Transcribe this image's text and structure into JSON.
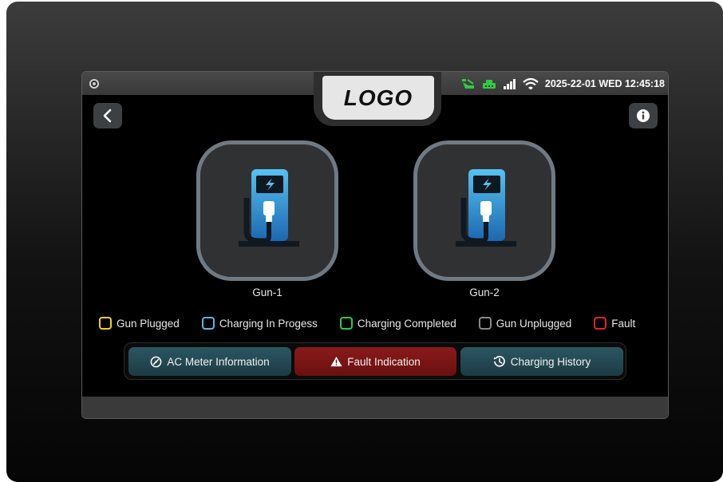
{
  "logo": {
    "text": "LOGO"
  },
  "status_bar": {
    "datetime": "2025-22-01 WED 12:45:18",
    "icons": [
      "camera-icon",
      "ev-connection-icon",
      "network-icon",
      "signal-bars-icon",
      "wifi-icon"
    ],
    "icon_color": "#2ecc40"
  },
  "nav": {
    "back_icon": "chevron-left-icon",
    "info_icon": "info-icon"
  },
  "guns": [
    {
      "label": "Gun-1",
      "icon": "ev-charger-icon"
    },
    {
      "label": "Gun-2",
      "icon": "ev-charger-icon"
    }
  ],
  "legend": [
    {
      "label": "Gun Plugged",
      "color": "#f2d21b"
    },
    {
      "label": "Charging In Progess",
      "color": "#5bb6e8"
    },
    {
      "label": "Charging Completed",
      "color": "#2ecc40"
    },
    {
      "label": "Gun Unplugged",
      "color": "#8a8a8a"
    },
    {
      "label": "Fault",
      "color": "#e02424"
    }
  ],
  "actions": {
    "meter_label": "AC Meter Information",
    "fault_label": "Fault Indication",
    "history_label": "Charging History"
  }
}
